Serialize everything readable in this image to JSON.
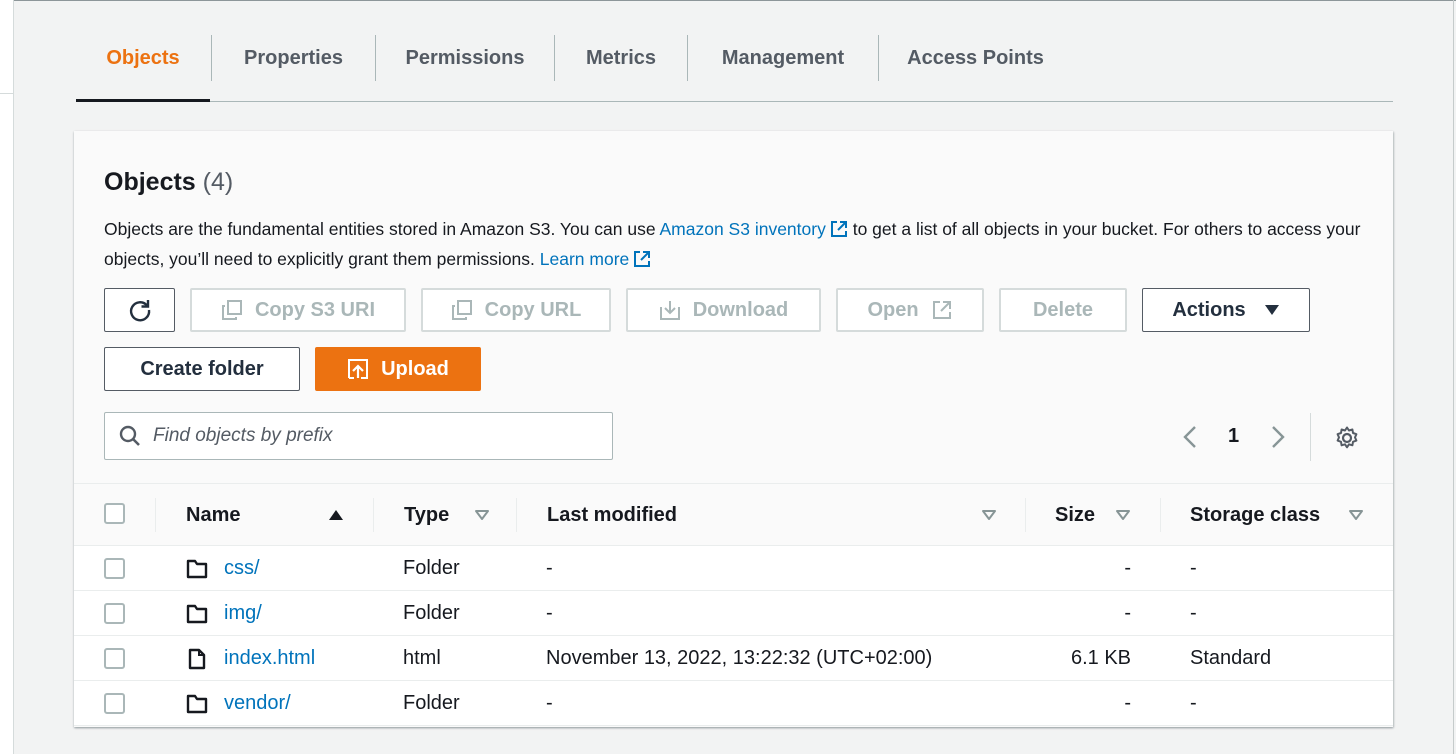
{
  "tabs": [
    {
      "label": "Objects",
      "active": true
    },
    {
      "label": "Properties",
      "active": false
    },
    {
      "label": "Permissions",
      "active": false
    },
    {
      "label": "Metrics",
      "active": false
    },
    {
      "label": "Management",
      "active": false
    },
    {
      "label": "Access Points",
      "active": false
    }
  ],
  "panel": {
    "title": "Objects",
    "count": "(4)",
    "desc_part1": "Objects are the fundamental entities stored in Amazon S3. You can use ",
    "inventory_link": "Amazon S3 inventory",
    "desc_part2": " to get a list of all objects in your bucket. For others to access your objects, you’ll need to explicitly grant them permissions. ",
    "learn_more": "Learn more"
  },
  "toolbar": {
    "refresh_icon": "refresh-icon",
    "copy_s3_uri": "Copy S3 URI",
    "copy_url": "Copy URL",
    "download": "Download",
    "open": "Open",
    "delete": "Delete",
    "actions": "Actions",
    "create_folder": "Create folder",
    "upload": "Upload"
  },
  "search": {
    "placeholder": "Find objects by prefix",
    "value": ""
  },
  "pagination": {
    "page": "1"
  },
  "table": {
    "columns": {
      "name": "Name",
      "type": "Type",
      "last_modified": "Last modified",
      "size": "Size",
      "storage_class": "Storage class"
    },
    "rows": [
      {
        "icon": "folder-icon",
        "name": "css/",
        "type": "Folder",
        "last_modified": "-",
        "size": "-",
        "storage_class": "-"
      },
      {
        "icon": "folder-icon",
        "name": "img/",
        "type": "Folder",
        "last_modified": "-",
        "size": "-",
        "storage_class": "-"
      },
      {
        "icon": "file-icon",
        "name": "index.html",
        "type": "html",
        "last_modified": "November 13, 2022, 13:22:32 (UTC+02:00)",
        "size": "6.1 KB",
        "storage_class": "Standard"
      },
      {
        "icon": "folder-icon",
        "name": "vendor/",
        "type": "Folder",
        "last_modified": "-",
        "size": "-",
        "storage_class": "-"
      }
    ]
  },
  "colors": {
    "accent_orange": "#ec7211",
    "link_blue": "#0073bb",
    "text_dark": "#16191f",
    "disabled": "#aab7b8"
  }
}
